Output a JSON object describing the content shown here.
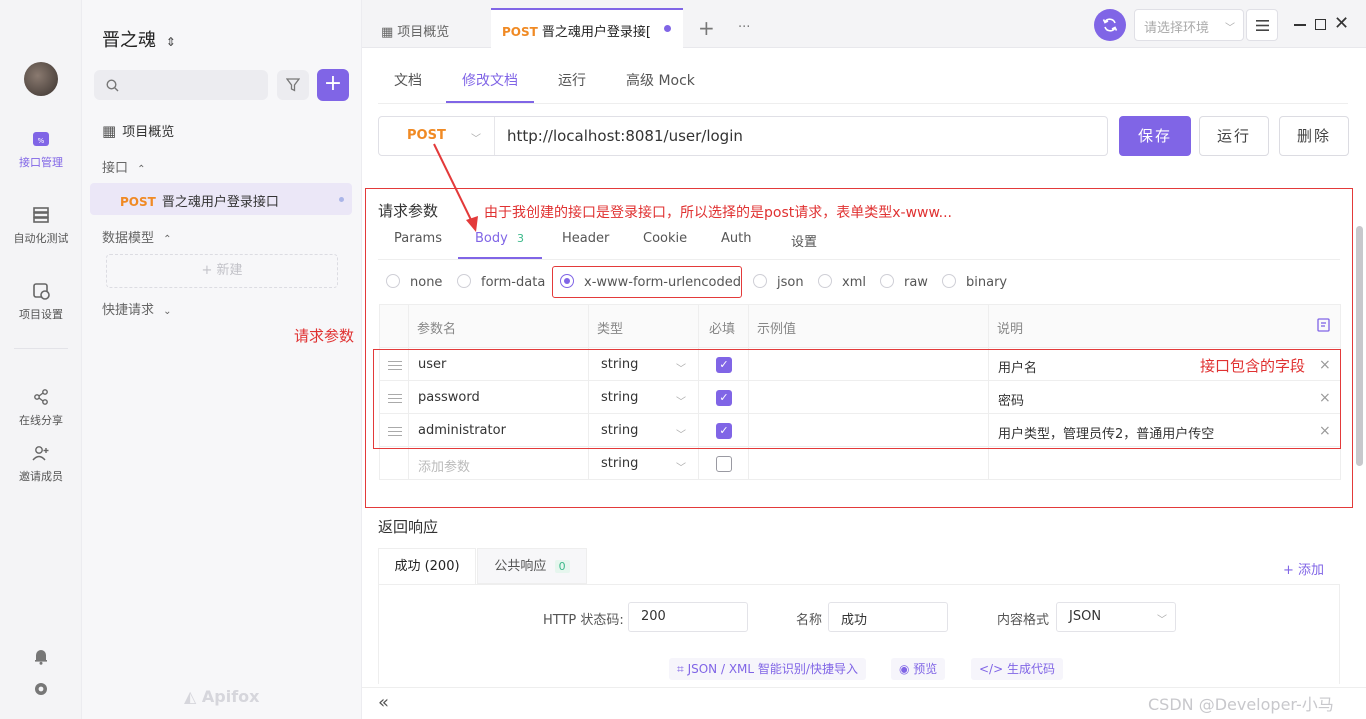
{
  "nav": {
    "items": [
      {
        "label": "接口管理",
        "icon": "api-icon"
      },
      {
        "label": "自动化测试",
        "icon": "automation-icon"
      },
      {
        "label": "项目设置",
        "icon": "settings-icon"
      },
      {
        "label": "在线分享",
        "icon": "share-icon"
      },
      {
        "label": "邀请成员",
        "icon": "invite-icon"
      }
    ]
  },
  "sidebar": {
    "project_name": "晋之魂",
    "overview": "项目概览",
    "section_api": "接口",
    "api_method": "POST",
    "api_name": "晋之魂用户登录接口",
    "section_models": "数据模型",
    "new_label": "+ 新建",
    "section_quick": "快捷请求",
    "logo": "Apifox"
  },
  "topbar": {
    "tab_overview": "项目概览",
    "tab_method": "POST",
    "tab_name": "晋之魂用户登录接[",
    "plus": "+",
    "more": "···",
    "env_placeholder": "请选择环境"
  },
  "doc_tabs": [
    "文档",
    "修改文档",
    "运行",
    "高级 Mock"
  ],
  "request": {
    "method": "POST",
    "url": "http://localhost:8081/user/login",
    "save": "保存",
    "run": "运行",
    "delete": "删除"
  },
  "params": {
    "title": "请求参数",
    "tabs": {
      "params": "Params",
      "body": "Body",
      "body_count": "3",
      "header": "Header",
      "cookie": "Cookie",
      "auth": "Auth",
      "settings": "设置"
    },
    "body_types": [
      "none",
      "form-data",
      "x-www-form-urlencoded",
      "json",
      "xml",
      "raw",
      "binary"
    ],
    "selected_type": "x-www-form-urlencoded",
    "columns": [
      "参数名",
      "类型",
      "必填",
      "示例值",
      "说明"
    ],
    "rows": [
      {
        "name": "user",
        "type": "string",
        "required": true,
        "example": "",
        "desc": "用户名"
      },
      {
        "name": "password",
        "type": "string",
        "required": true,
        "example": "",
        "desc": "密码"
      },
      {
        "name": "administrator",
        "type": "string",
        "required": true,
        "example": "",
        "desc": "用户类型，管理员传2，普通用户传空"
      }
    ],
    "add_row": {
      "placeholder": "添加参数",
      "type": "string"
    }
  },
  "annotations": {
    "top_note": "由于我创建的接口是登录接口，所以选择的是post请求，表单类型x-www...",
    "left_note": "请求参数",
    "fields_note": "接口包含的字段"
  },
  "response": {
    "title": "返回响应",
    "tab_success": "成功 (200)",
    "tab_common": "公共响应",
    "tab_common_count": "0",
    "add": "+ 添加",
    "status_label": "HTTP 状态码:",
    "status_value": "200",
    "name_label": "名称",
    "name_value": "成功",
    "format_label": "内容格式",
    "format_value": "JSON",
    "link_import": "JSON / XML 智能识别/快捷导入",
    "link_preview": "预览",
    "link_codegen": "生成代码"
  },
  "bottom": {
    "collapse": "«",
    "watermark": "CSDN @Developer-小马"
  },
  "colors": {
    "accent": "#8065e6",
    "post": "#f08a24",
    "annotation": "#e33a3a"
  }
}
